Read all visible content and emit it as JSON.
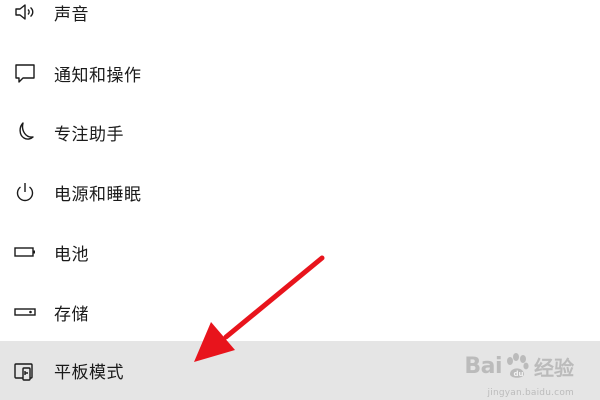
{
  "settings_nav": {
    "items": [
      {
        "label": "声音",
        "icon": "speaker-icon"
      },
      {
        "label": "通知和操作",
        "icon": "notification-icon"
      },
      {
        "label": "专注助手",
        "icon": "moon-icon"
      },
      {
        "label": "电源和睡眠",
        "icon": "power-icon"
      },
      {
        "label": "电池",
        "icon": "battery-icon"
      },
      {
        "label": "存储",
        "icon": "storage-icon"
      },
      {
        "label": "平板模式",
        "icon": "tablet-mode-icon",
        "selected": true
      }
    ]
  },
  "annotation": {
    "arrow_color": "#e8141c"
  },
  "watermark": {
    "brand_left": "Bai",
    "brand_right": "经验",
    "url": "jingyan.baidu.com"
  },
  "colors": {
    "selected_background": "#e5e5e5",
    "text": "#1a1a1a"
  }
}
